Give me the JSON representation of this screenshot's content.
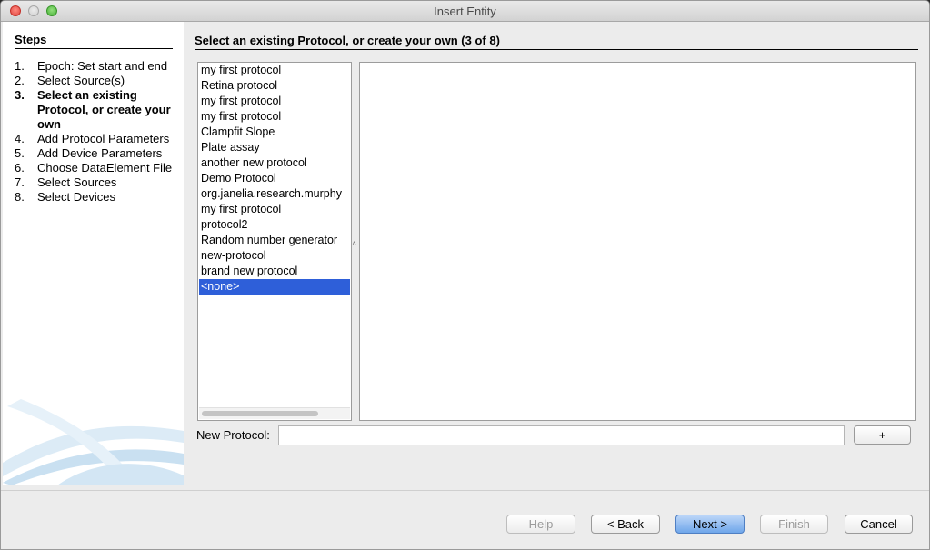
{
  "window": {
    "title": "Insert Entity"
  },
  "steps": {
    "title": "Steps",
    "items": [
      {
        "num": "1.",
        "label": "Epoch: Set start and end"
      },
      {
        "num": "2.",
        "label": "Select Source(s)"
      },
      {
        "num": "3.",
        "label": "Select an existing Protocol, or create your own"
      },
      {
        "num": "4.",
        "label": "Add Protocol Parameters"
      },
      {
        "num": "5.",
        "label": "Add Device Parameters"
      },
      {
        "num": "6.",
        "label": "Choose DataElement File"
      },
      {
        "num": "7.",
        "label": "Select Sources"
      },
      {
        "num": "8.",
        "label": "Select Devices"
      }
    ]
  },
  "content": {
    "title": "Select an existing Protocol, or create your own (3 of 8)"
  },
  "protocols": {
    "items": [
      "my first protocol",
      "Retina protocol",
      "my first protocol",
      "my first protocol",
      "Clampfit Slope",
      "Plate assay",
      "another new protocol",
      "Demo Protocol",
      "org.janelia.research.murphy",
      "my first protocol",
      "protocol2",
      "Random number generator",
      "new-protocol",
      "brand new protocol",
      "<none>"
    ],
    "selected": "<none>"
  },
  "new_protocol": {
    "label": "New Protocol:",
    "value": "",
    "add_label": "+"
  },
  "buttons": {
    "help": "Help",
    "back": "< Back",
    "next": "Next >",
    "finish": "Finish",
    "cancel": "Cancel"
  },
  "colors": {
    "selection": "#2e5fd9",
    "primary_button": "#6fa6ea"
  }
}
